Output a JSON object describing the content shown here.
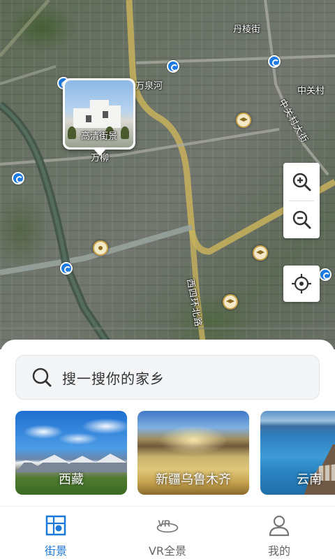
{
  "map": {
    "labels": {
      "danling_street": "丹棱街",
      "wanquan_river": "万泉河",
      "zhongguancun": "中关村",
      "zhongguancun_street": "中关村大街",
      "wanliu": "万柳",
      "west_fourth_ring": "西四环北路"
    },
    "street_view_card": {
      "caption": "高清街景"
    },
    "controls": {
      "zoom_in_icon": "zoom-in-icon",
      "zoom_out_icon": "zoom-out-icon",
      "locate_icon": "crosshair-icon"
    }
  },
  "search": {
    "placeholder": "搜一搜你的家乡"
  },
  "places": [
    {
      "name": "西藏"
    },
    {
      "name": "新疆乌鲁木齐"
    },
    {
      "name": "云南"
    }
  ],
  "tabs": [
    {
      "label": "街景",
      "icon": "street-view-icon",
      "active": true
    },
    {
      "label": "VR全景",
      "icon": "vr-icon",
      "active": false
    },
    {
      "label": "我的",
      "icon": "profile-icon",
      "active": false
    }
  ],
  "colors": {
    "accent": "#1d78d6",
    "subway": "#1e7ae0"
  }
}
